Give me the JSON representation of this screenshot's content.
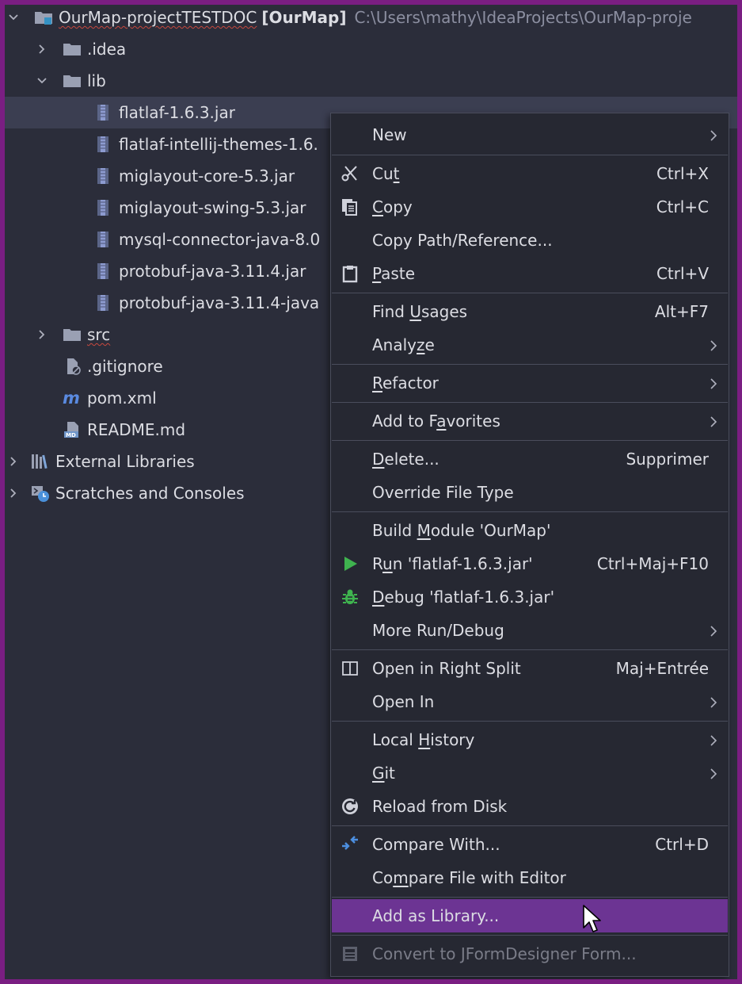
{
  "project_tree": {
    "root": {
      "name": "OurMap-projectTESTDOC",
      "module": "[OurMap]",
      "path": "C:\\Users\\mathy\\IdeaProjects\\OurMap-proje"
    },
    "idea": ".idea",
    "lib": "lib",
    "jars": [
      "flatlaf-1.6.3.jar",
      "flatlaf-intellij-themes-1.6.",
      "miglayout-core-5.3.jar",
      "miglayout-swing-5.3.jar",
      "mysql-connector-java-8.0",
      "protobuf-java-3.11.4.jar",
      "protobuf-java-3.11.4-java"
    ],
    "src": "src",
    "gitignore": ".gitignore",
    "pom": "pom.xml",
    "readme": "README.md",
    "external_libraries": "External Libraries",
    "scratches": "Scratches and Consoles"
  },
  "context_menu": {
    "new": "New",
    "cut": {
      "pre": "Cu",
      "u": "t",
      "post": "",
      "shortcut": "Ctrl+X"
    },
    "copy": {
      "pre": "",
      "u": "C",
      "post": "opy",
      "shortcut": "Ctrl+C"
    },
    "copy_path": "Copy Path/Reference...",
    "paste": {
      "pre": "",
      "u": "P",
      "post": "aste",
      "shortcut": "Ctrl+V"
    },
    "find_usages": {
      "pre": "Find ",
      "u": "U",
      "post": "sages",
      "shortcut": "Alt+F7"
    },
    "analyze": {
      "pre": "Analy",
      "u": "z",
      "post": "e"
    },
    "refactor": {
      "pre": "",
      "u": "R",
      "post": "efactor"
    },
    "add_favorites": {
      "pre": "Add to F",
      "u": "a",
      "post": "vorites"
    },
    "delete": {
      "pre": "",
      "u": "D",
      "post": "elete...",
      "shortcut": "Supprimer"
    },
    "override_file_type": "Override File Type",
    "build_module": {
      "pre": "Build ",
      "u": "M",
      "post": "odule 'OurMap'"
    },
    "run": {
      "pre": "R",
      "u": "u",
      "post": "n 'flatlaf-1.6.3.jar'",
      "shortcut": "Ctrl+Maj+F10"
    },
    "debug": {
      "pre": "",
      "u": "D",
      "post": "ebug 'flatlaf-1.6.3.jar'"
    },
    "more_run_debug": "More Run/Debug",
    "open_right_split": {
      "label": "Open in Right Split",
      "shortcut": "Maj+Entrée"
    },
    "open_in": "Open In",
    "local_history": {
      "pre": "Local ",
      "u": "H",
      "post": "istory"
    },
    "git": {
      "pre": "",
      "u": "G",
      "post": "it"
    },
    "reload": "Reload from Disk",
    "compare_with": {
      "label": "Compare With...",
      "shortcut": "Ctrl+D"
    },
    "compare_editor": {
      "pre": "Co",
      "u": "m",
      "post": "pare File with Editor"
    },
    "add_library": "Add as Library...",
    "convert_jform": "Convert to JFormDesigner Form..."
  },
  "colors": {
    "background": "#2b2d3a",
    "menu_background": "#262832",
    "highlight": "#6c3493",
    "frame": "#7a1e82"
  }
}
